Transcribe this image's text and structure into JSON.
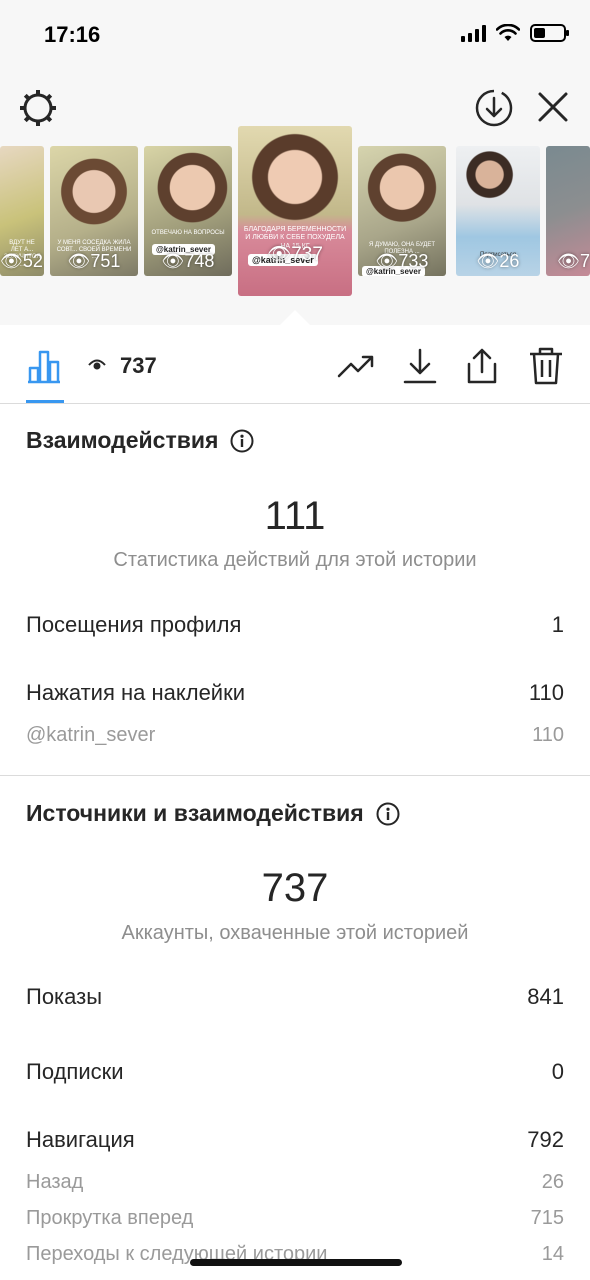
{
  "status_bar": {
    "time": "17:16"
  },
  "stories": [
    {
      "views": "52",
      "caption": "ВДУТ НЕ ЛЕТ А... ЗОЛУЧИТСЯ ...",
      "bg": "#c9c27a"
    },
    {
      "views": "751",
      "caption": "У МЕНЯ СОСЕДКА ЖИЛА СОВТ... СВОЕЙ ВРЕМЕНИ ...",
      "bg": "#b5b08a"
    },
    {
      "views": "748",
      "caption": "ОТВЕЧАЮ НА ВОПРОСЫ",
      "tag": "@katrin_sever",
      "bg": "#9f9c7a"
    },
    {
      "views": "737",
      "caption": "БЛАГОДАРЯ БЕРЕМЕННОСТИ И ЛЮБВИ К СЕБЕ ПОХУДЕЛА НА 15 КГ",
      "tag": "@katrin_sever",
      "bg": "#c2b88a",
      "selected": true
    },
    {
      "views": "733",
      "caption": "Я ДУМАЮ, ОНА БУДЕТ ПОЛЕЗНА ...",
      "tag": "@katrin_sever",
      "bg": "#a9a68a"
    },
    {
      "views": "26",
      "caption": "Подписаться",
      "bg": "#dfe2e5"
    },
    {
      "views": "7",
      "caption": "",
      "bg": "#8c8e90"
    }
  ],
  "toolbar": {
    "views_count": "737"
  },
  "interactions": {
    "title": "Взаимодействия",
    "total": "111",
    "caption": "Статистика действий для этой истории",
    "rows": [
      {
        "label": "Посещения профиля",
        "value": "1"
      },
      {
        "label": "Нажатия на наклейки",
        "value": "110"
      }
    ],
    "sub_rows": [
      {
        "label": "@katrin_sever",
        "value": "110"
      }
    ]
  },
  "discovery": {
    "title": "Источники и взаимодействия",
    "total": "737",
    "caption": "Аккаунты, охваченные этой историей",
    "rows": [
      {
        "label": "Показы",
        "value": "841"
      },
      {
        "label": "Подписки",
        "value": "0"
      },
      {
        "label": "Навигация",
        "value": "792"
      }
    ],
    "sub_rows": [
      {
        "label": "Назад",
        "value": "26"
      },
      {
        "label": "Прокрутка вперед",
        "value": "715"
      },
      {
        "label": "Переходы к следующей истории",
        "value": "14"
      }
    ]
  },
  "colors": {
    "accent": "#3897f0",
    "text": "#262626",
    "secondary": "#8e8e8e"
  }
}
